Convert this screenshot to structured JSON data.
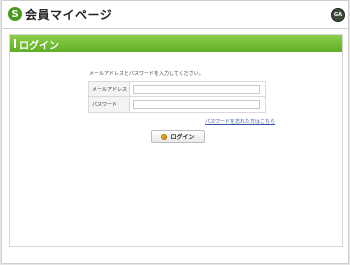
{
  "header": {
    "logo_mark": "S",
    "site_title": "会員マイページ",
    "corner_logo_text": "GA"
  },
  "section": {
    "title": "ログイン"
  },
  "login": {
    "instruction": "メールアドレスとパスワードを入力してください。",
    "email_label": "メールアドレス",
    "email_value": "",
    "password_label": "パスワード",
    "password_value": "",
    "forgot_link": "パスワードを忘れた方はこちら",
    "submit_label": "ログイン"
  },
  "colors": {
    "accent_green": "#5fae24",
    "link_blue": "#3355aa"
  }
}
